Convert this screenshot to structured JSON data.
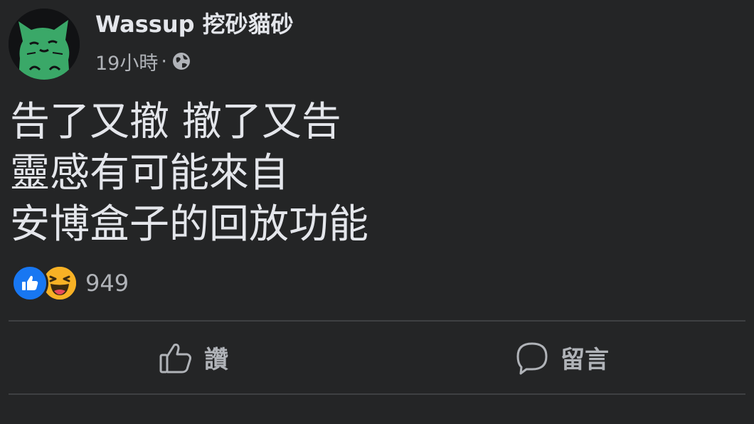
{
  "post": {
    "author": "Wassup 挖砂貓砂",
    "time": "19小時",
    "separator": "·",
    "privacy_icon": "globe-icon",
    "text_lines": [
      "告了又撤 撤了又告",
      "靈感有可能來自",
      "安博盒子的回放功能"
    ]
  },
  "reactions": {
    "icons": [
      "like-reaction-icon",
      "haha-reaction-icon"
    ],
    "count": "949"
  },
  "actions": {
    "like_label": "讚",
    "comment_label": "留言"
  },
  "colors": {
    "background": "#242526",
    "primary_text": "#e4e6eb",
    "secondary_text": "#b0b3b8",
    "like_blue": "#1877f2",
    "haha_yellow": "#f7b125",
    "avatar_green": "#3aa868"
  }
}
